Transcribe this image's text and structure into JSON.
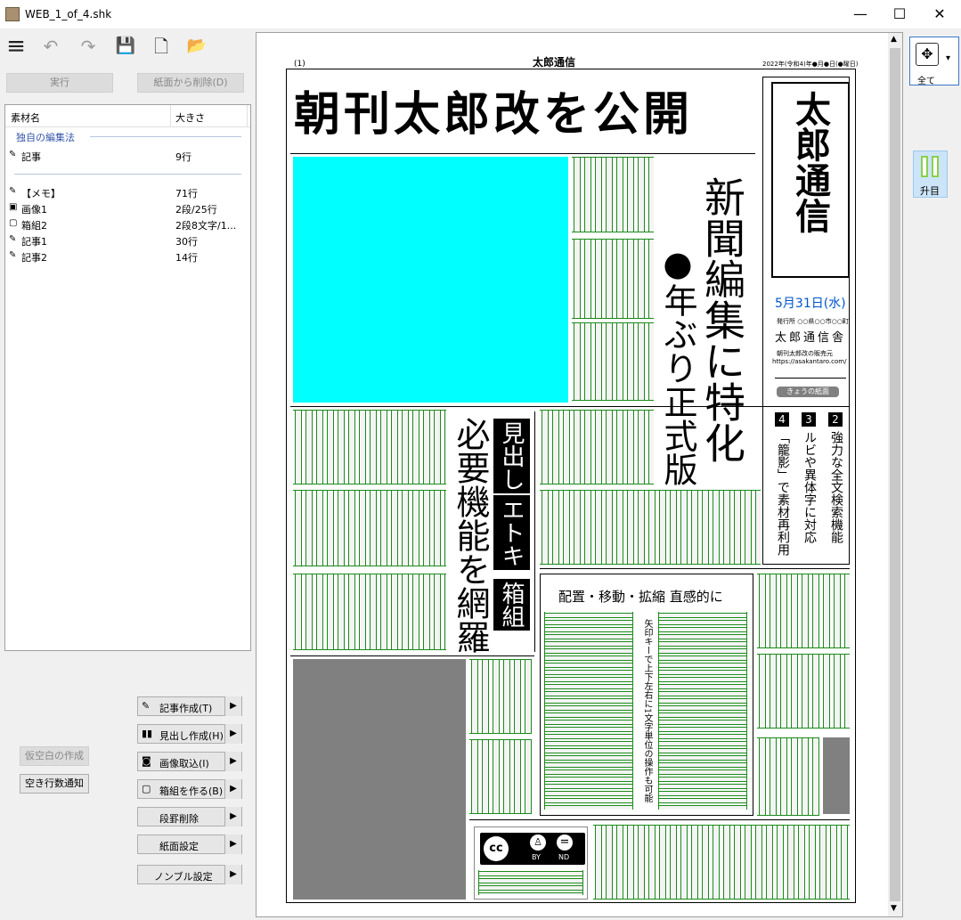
{
  "window": {
    "title": "WEB_1_of_4.shk",
    "minimize": "—",
    "maximize": "☐",
    "close": "✕"
  },
  "toolbar": {
    "menu_icon": "≡",
    "undo_icon": "↶",
    "redo_icon": "↷",
    "save_icon": "💾",
    "new_icon": "🗋",
    "open_icon": "📂"
  },
  "actions": {
    "run": "実行",
    "remove": "紙面から削除(D)"
  },
  "list": {
    "col_name": "素材名",
    "col_size": "大きさ",
    "group_label": "独自の編集法",
    "items": [
      {
        "icon": "✎",
        "name": "記事",
        "size": "9行"
      },
      {
        "icon": "✎",
        "name": "【メモ】",
        "size": "71行"
      },
      {
        "icon": "▣",
        "name": "画像1",
        "size": "2段/25行"
      },
      {
        "icon": "▢",
        "name": "箱組2",
        "size": "2段8文字/1..."
      },
      {
        "icon": "✎",
        "name": "記事1",
        "size": "30行"
      },
      {
        "icon": "✎",
        "name": "記事2",
        "size": "14行"
      }
    ]
  },
  "side": {
    "article_create": "記事作成(T)",
    "headline_create": "見出し作成(H)",
    "image_import": "画像取込(I)",
    "box_create": "箱組を作る(B)",
    "para_delete": "段罫削除",
    "page_settings": "紙面設定",
    "sample_settings": "ノンブル設定",
    "temp_blank": "仮空白の作成",
    "blank_notify": "空き行数通知",
    "arrow": "▶"
  },
  "paper": {
    "fold_left": "(1)",
    "fold_center": "太郎通信",
    "fold_right": "2022年(令和4)年●月●日(●曜日)",
    "headline": "朝刊太郎改を公開",
    "vertical_title": "新聞編集に特化",
    "vertical_sub": "●年ぶり正式版",
    "logo_text": "太郎通信",
    "date": "5月31日(水)",
    "publisher_line1": "発行所 ○○県○○市○○町",
    "publisher": "太郎通信舎",
    "publisher_url": "朝刊太郎改の販売元",
    "url": "https://asakantaro.com/",
    "today_label": "きょうの紙面",
    "idx2_num": "2",
    "idx2": "強力な全文検索機能",
    "idx3_num": "3",
    "idx3": "ルビや異体字に対応",
    "idx4_num": "4",
    "idx4": "「籠影」で素材再利用",
    "left_vertical": "必要機能を網羅",
    "black_vertical_1": "見出し",
    "black_vertical_2": "エトキ",
    "black_vertical_3": "箱組",
    "box_title": "配置・移動・拡縮 直感的に",
    "box_vertical": "矢印キーで上下左右に1文字単位の操作も可能",
    "cc": "cc",
    "cc_by": "BY",
    "cc_nd": "ND"
  },
  "right_panel": {
    "view_all": "全て",
    "view_icon": "✥",
    "sort_label": "升目",
    "dropdown": "▾"
  },
  "colors": {
    "accent": "#3a78c8",
    "image_cyan": "#00ffff",
    "image_gray": "#808080",
    "text_green": "#1a8a1a",
    "link_blue": "#0055cc"
  }
}
